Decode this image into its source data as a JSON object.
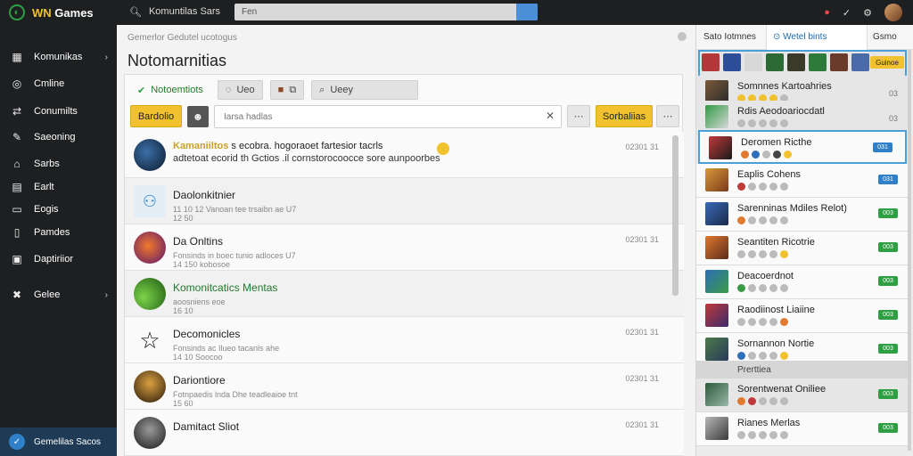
{
  "topbar": {
    "logo_prefix": "WN",
    "logo_suffix": "Games",
    "search_label": "Komuntilas Sars",
    "search_value": "Fen",
    "icons": [
      "notification-icon",
      "leaf-icon",
      "settings-icon"
    ]
  },
  "sidebar": {
    "items": [
      {
        "label": "Komunikas",
        "icon": "grid-icon"
      },
      {
        "label": "Cmline",
        "icon": "search-icon"
      },
      {
        "label": "Conumilts",
        "icon": "share-icon"
      },
      {
        "label": "Saeoning",
        "icon": "edit-icon"
      },
      {
        "label": "Sarbs",
        "icon": "home-icon"
      },
      {
        "label": "Earlt",
        "icon": "calendar-icon"
      },
      {
        "label": "Eogis",
        "icon": "folder-icon"
      },
      {
        "label": "Pamdes",
        "icon": "document-icon"
      },
      {
        "label": "Daptiriior",
        "icon": "box-icon"
      },
      {
        "label": "Gelee",
        "icon": "controller-icon"
      }
    ],
    "footer_label": "Gemelilas Sacos"
  },
  "main": {
    "breadcrumb": "Gemerlor Gedutel ucotogus",
    "title": "Notomarnitias",
    "tabs": [
      {
        "label": "Notoemtiots",
        "icon": "check-icon"
      },
      {
        "label": "Ueo",
        "icon": "chat-icon"
      },
      {
        "label": "",
        "icon": "bookmark-icon"
      },
      {
        "label": "Ueey",
        "icon": "search-icon"
      }
    ],
    "filter_button": "Bardolio",
    "filter_placeholder": "Iarsa hadlas",
    "action_button": "Sorbaliias",
    "feed": [
      {
        "type": "featured",
        "title_highlight": "Kamaniiltos",
        "title_rest": "s ecobra. hogoraoet fartesior tacrls",
        "body": "adtetoat ecorid th Gctios .il cornstorocoocce sore aunpoorbes",
        "time": "02301 31",
        "avatar": "hat-avatar"
      },
      {
        "type": "post",
        "title": "Daolonkitnier",
        "meta": "11 10 12   Vanoan tee trsaibn ae  U7",
        "sub": "12 50",
        "time": "",
        "avatar": "people-icon"
      },
      {
        "type": "post",
        "title": "Da Onltins",
        "meta": "Fonsinds in boec tunio adloces U7",
        "sub": "14 150   kobosoe",
        "time": "02301 31",
        "avatar": "fire-avatar"
      },
      {
        "type": "post",
        "title": "Komonitcatics Mentas",
        "meta": "aoosniens   eoe",
        "sub": "16 10",
        "time": "",
        "avatar": "leaf-avatar"
      },
      {
        "type": "post",
        "title": "Decomonicles",
        "meta": "Fonsinds ac Ilueo tacanls ahe",
        "sub": "14 10   Soocoo",
        "time": "02301 31",
        "avatar": "star-icon"
      },
      {
        "type": "post",
        "title": "Dariontiore",
        "meta": "Fotnpaedis lnda Dhe teadleaioe tnt",
        "sub": "15 60",
        "time": "02301 31",
        "avatar": "armor-avatar"
      },
      {
        "type": "post",
        "title": "Damitact Sliot",
        "meta": "",
        "sub": "",
        "time": "02301 31",
        "avatar": "knight-avatar"
      }
    ]
  },
  "right_panel": {
    "tabs": [
      "Sato Iotmnes",
      "Wetel bints",
      "Gsmo"
    ],
    "strip_badge": "Guinoe",
    "featured_rows": [
      {
        "title": "Somnnes Kartoahries",
        "count": "03"
      },
      {
        "title": "Rdis Aeodoariocdatl",
        "count": "03"
      }
    ],
    "rows": [
      {
        "title": "Deromen Ricthe",
        "badge": "031",
        "badge_color": "#2f80c8"
      },
      {
        "title": "Eaplis Cohens",
        "badge": "031",
        "badge_color": "#2f80c8"
      },
      {
        "title": "Sarenninas Mdiles Relot)",
        "badge": "003",
        "badge_color": "#2ea043"
      },
      {
        "title": "Seantiten Ricotrie",
        "badge": "003",
        "badge_color": "#2ea043"
      },
      {
        "title": "Deacoerdnot",
        "badge": "003",
        "badge_color": "#2ea043"
      },
      {
        "title": "Raodiinost Liaiine",
        "badge": "003",
        "badge_color": "#2ea043"
      },
      {
        "title": "Sornannon Nortie",
        "badge": "003",
        "badge_color": "#2ea043"
      }
    ],
    "section_label": "Prerttiea",
    "bottom_rows": [
      {
        "title": "Sorentwenat Oniliee",
        "badge": "003",
        "badge_color": "#2ea043"
      },
      {
        "title": "Rianes Merlas",
        "badge": "003",
        "badge_color": "#2ea043"
      }
    ]
  },
  "colors": {
    "accent_yellow": "#f2c12e",
    "accent_green": "#2ea043",
    "accent_blue": "#2f80c8",
    "sidebar_bg": "#1d1f21"
  }
}
